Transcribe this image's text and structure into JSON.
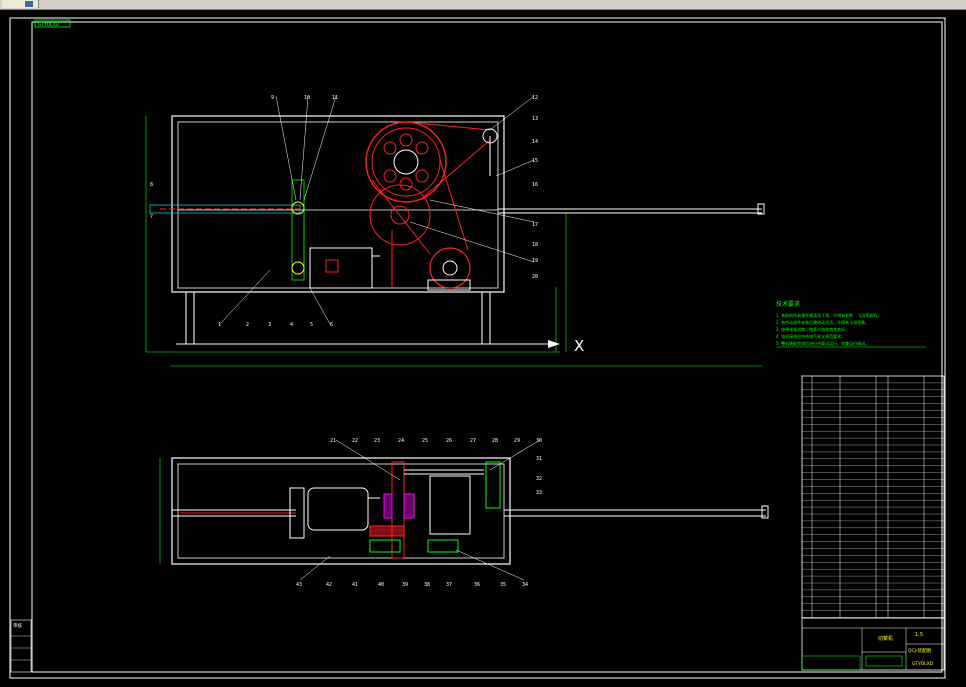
{
  "window": {
    "title_tag": "GTYOLXD"
  },
  "colors": {
    "frame": "#ffffff",
    "cyan": "#00c8c8",
    "green": "#00ff00",
    "red": "#ff2020",
    "yellow": "#ffff00",
    "magenta": "#ff00ff",
    "blue": "#4060ff",
    "white": "#ffffff"
  },
  "drawing": {
    "top_balloons": [
      "9",
      "10",
      "11",
      "12",
      "13",
      "14",
      "15",
      "16",
      "17",
      "18",
      "19",
      "20",
      "8",
      "7",
      "1",
      "2",
      "3",
      "4",
      "5",
      "6"
    ],
    "bottom_balloons": [
      "21",
      "22",
      "23",
      "24",
      "25",
      "26",
      "27",
      "28",
      "29",
      "30",
      "31",
      "32",
      "33",
      "34",
      "35",
      "36",
      "37",
      "38",
      "39",
      "40",
      "41",
      "42",
      "43"
    ],
    "axis_mark": "X"
  },
  "tech_requirements": {
    "title": "技术要求",
    "lines": [
      "1. 装配前所有零件需清洗干净，不得有毛刺、飞边等缺陷。",
      "2. 各传动部件安装后需转动灵活，不得有卡滞现象。",
      "3. 皮带张紧适度，链条与链轮啮合良好。",
      "4. 电机接线应符合电气安全规范要求。",
      "5. 整机装配完成后进行空载试运行，检查运行情况。"
    ]
  },
  "title_block": {
    "name": "切菜机",
    "drawing_no": "GTYOLXD",
    "scale": "1:5",
    "code": "QCJ-装配图"
  },
  "left_stamp": {
    "title": "审核"
  }
}
